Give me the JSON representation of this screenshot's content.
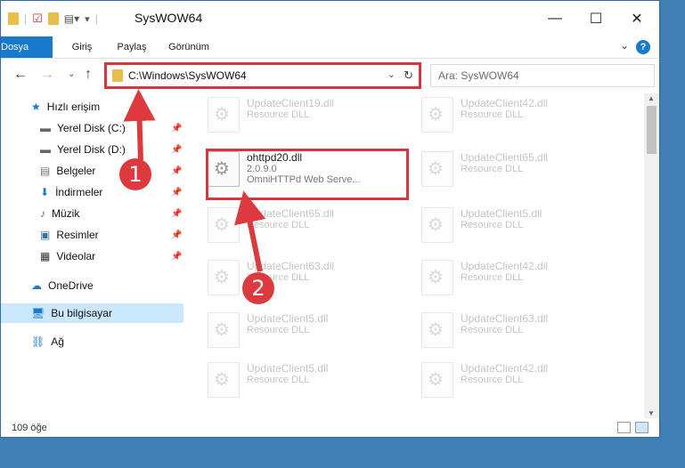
{
  "window": {
    "title": "SysWOW64"
  },
  "ribbon": {
    "tabs": [
      "Dosya",
      "Giriş",
      "Paylaş",
      "Görünüm"
    ]
  },
  "address": {
    "path": "C:\\Windows\\SysWOW64"
  },
  "search": {
    "placeholder": "Ara: SysWOW64"
  },
  "sidebar": {
    "items": [
      {
        "label": "Hızlı erişim",
        "icon": "star-icon",
        "pinned": false
      },
      {
        "label": "Yerel Disk (C:)",
        "icon": "drive-icon",
        "pinned": true
      },
      {
        "label": "Yerel Disk (D:)",
        "icon": "drive-icon",
        "pinned": true
      },
      {
        "label": "Belgeler",
        "icon": "document-icon",
        "pinned": true
      },
      {
        "label": "İndirmeler",
        "icon": "download-icon",
        "pinned": true
      },
      {
        "label": "Müzik",
        "icon": "music-icon",
        "pinned": true
      },
      {
        "label": "Resimler",
        "icon": "pictures-icon",
        "pinned": true
      },
      {
        "label": "Videolar",
        "icon": "video-icon",
        "pinned": true
      },
      {
        "label": "OneDrive",
        "icon": "cloud-icon",
        "pinned": false
      },
      {
        "label": "Bu bilgisayar",
        "icon": "computer-icon",
        "pinned": false
      },
      {
        "label": "Ağ",
        "icon": "network-icon",
        "pinned": false
      }
    ]
  },
  "files": {
    "left": [
      {
        "name": "UpdateClient19.dll",
        "type": "Resource DLL"
      },
      {
        "name": "ohttpd20.dll",
        "version": "2.0.9.0",
        "type": "OmniHTTPd Web Serve..."
      },
      {
        "name": "UpdateClient65.dll",
        "type": "Resource DLL"
      },
      {
        "name": "UpdateClient63.dll",
        "type": "Resource DLL"
      },
      {
        "name": "UpdateClient5.dll",
        "type": "Resource DLL"
      },
      {
        "name": "UpdateClient5.dll",
        "type": "Resource DLL"
      }
    ],
    "right": [
      {
        "name": "UpdateClient42.dll",
        "type": "Resource DLL"
      },
      {
        "name": "UpdateClient65.dll",
        "type": "Resource DLL"
      },
      {
        "name": "UpdateClient5.dll",
        "type": "Resource DLL"
      },
      {
        "name": "UpdateClient42.dll",
        "type": "Resource DLL"
      },
      {
        "name": "UpdateClient63.dll",
        "type": "Resource DLL"
      },
      {
        "name": "UpdateClient42.dll",
        "type": "Resource DLL"
      }
    ]
  },
  "status": {
    "count": "109 öğe"
  },
  "callouts": {
    "one": "1",
    "two": "2"
  },
  "colors": {
    "accent": "#1979ca",
    "callout": "#dd3a3f",
    "selection": "#cce8ff"
  }
}
